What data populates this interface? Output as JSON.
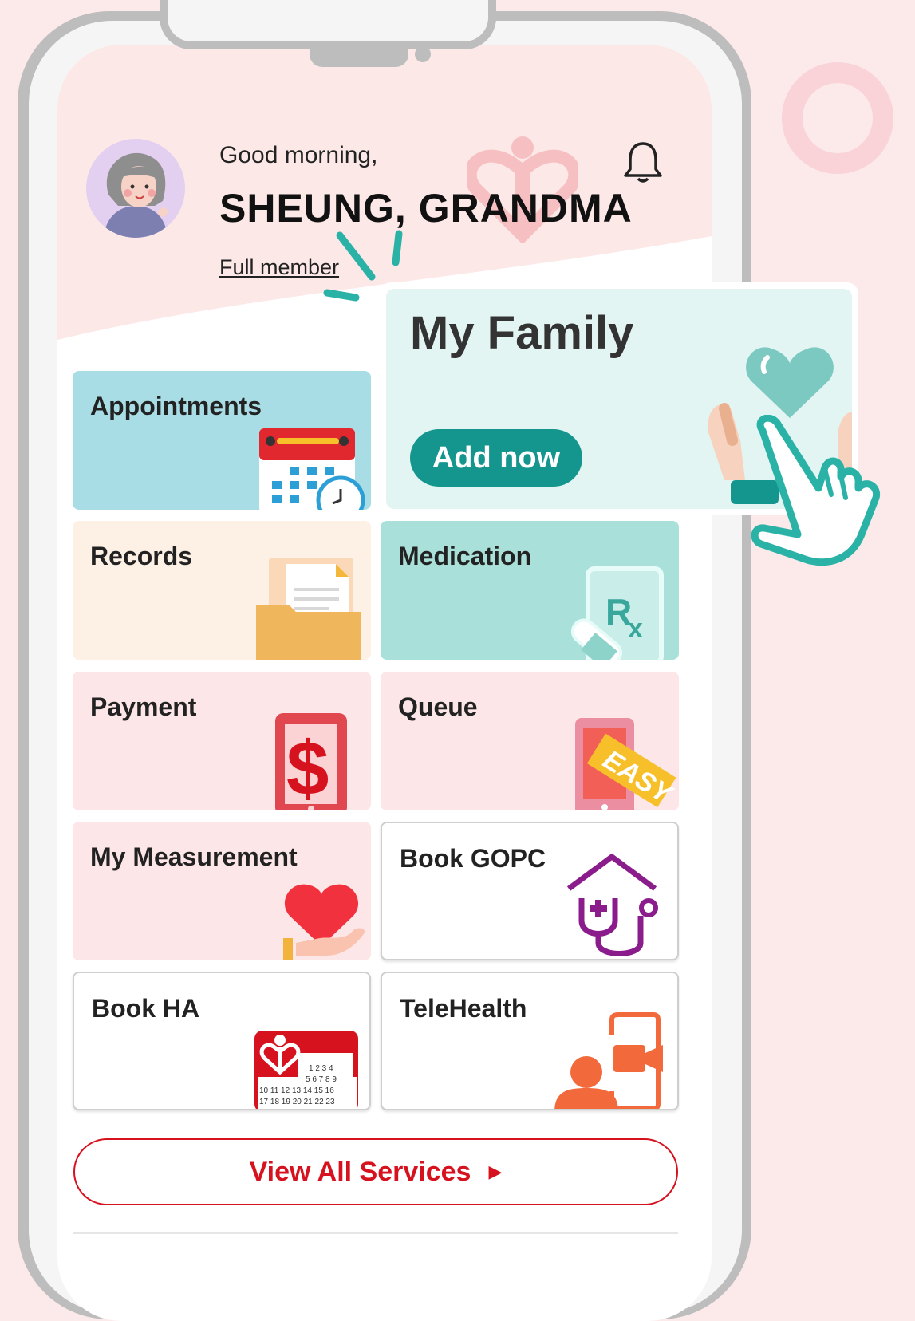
{
  "header": {
    "greeting": "Good morning,",
    "user_name": "SHEUNG, GRANDMA",
    "membership": "Full member"
  },
  "services": [
    {
      "id": "appointments",
      "label": "Appointments",
      "bg": "#a9dde6"
    },
    {
      "id": "records",
      "label": "Records",
      "bg": "#fdf0e4"
    },
    {
      "id": "medication",
      "label": "Medication",
      "bg": "#a9e0da"
    },
    {
      "id": "payment",
      "label": "Payment",
      "bg": "#fce6e7"
    },
    {
      "id": "queue",
      "label": "Queue",
      "bg": "#fce6e7"
    },
    {
      "id": "my_measurement",
      "label": "My Measurement",
      "bg": "#fce6e7"
    },
    {
      "id": "book_gopc",
      "label": "Book GOPC",
      "bg": "#ffffff"
    },
    {
      "id": "book_ha",
      "label": "Book HA",
      "bg": "#ffffff"
    },
    {
      "id": "telehealth",
      "label": "TeleHealth",
      "bg": "#ffffff"
    }
  ],
  "calendar_icon_numbers": [
    "1 2 3 4",
    "5 6 7 8 9",
    "10 11 12 13 14 15 16",
    "17 18 19 20 21 22 23"
  ],
  "view_all": {
    "label": "View All Services"
  },
  "family_callout": {
    "title": "My Family",
    "button": "Add now"
  },
  "colors": {
    "brand_red": "#d7121f",
    "family_teal": "#14968e",
    "page_bg": "#fce9ea",
    "header_bg": "#fde8e8"
  },
  "icons": [
    "bell-icon",
    "calendar-icon",
    "folder-icon",
    "prescription-icon",
    "dollar-icon",
    "queue-ticket-icon",
    "heart-hand-icon",
    "clinic-stethoscope-icon",
    "ha-calendar-icon",
    "video-call-icon",
    "heart-icon",
    "pointer-hand-icon",
    "caret-right-icon"
  ]
}
